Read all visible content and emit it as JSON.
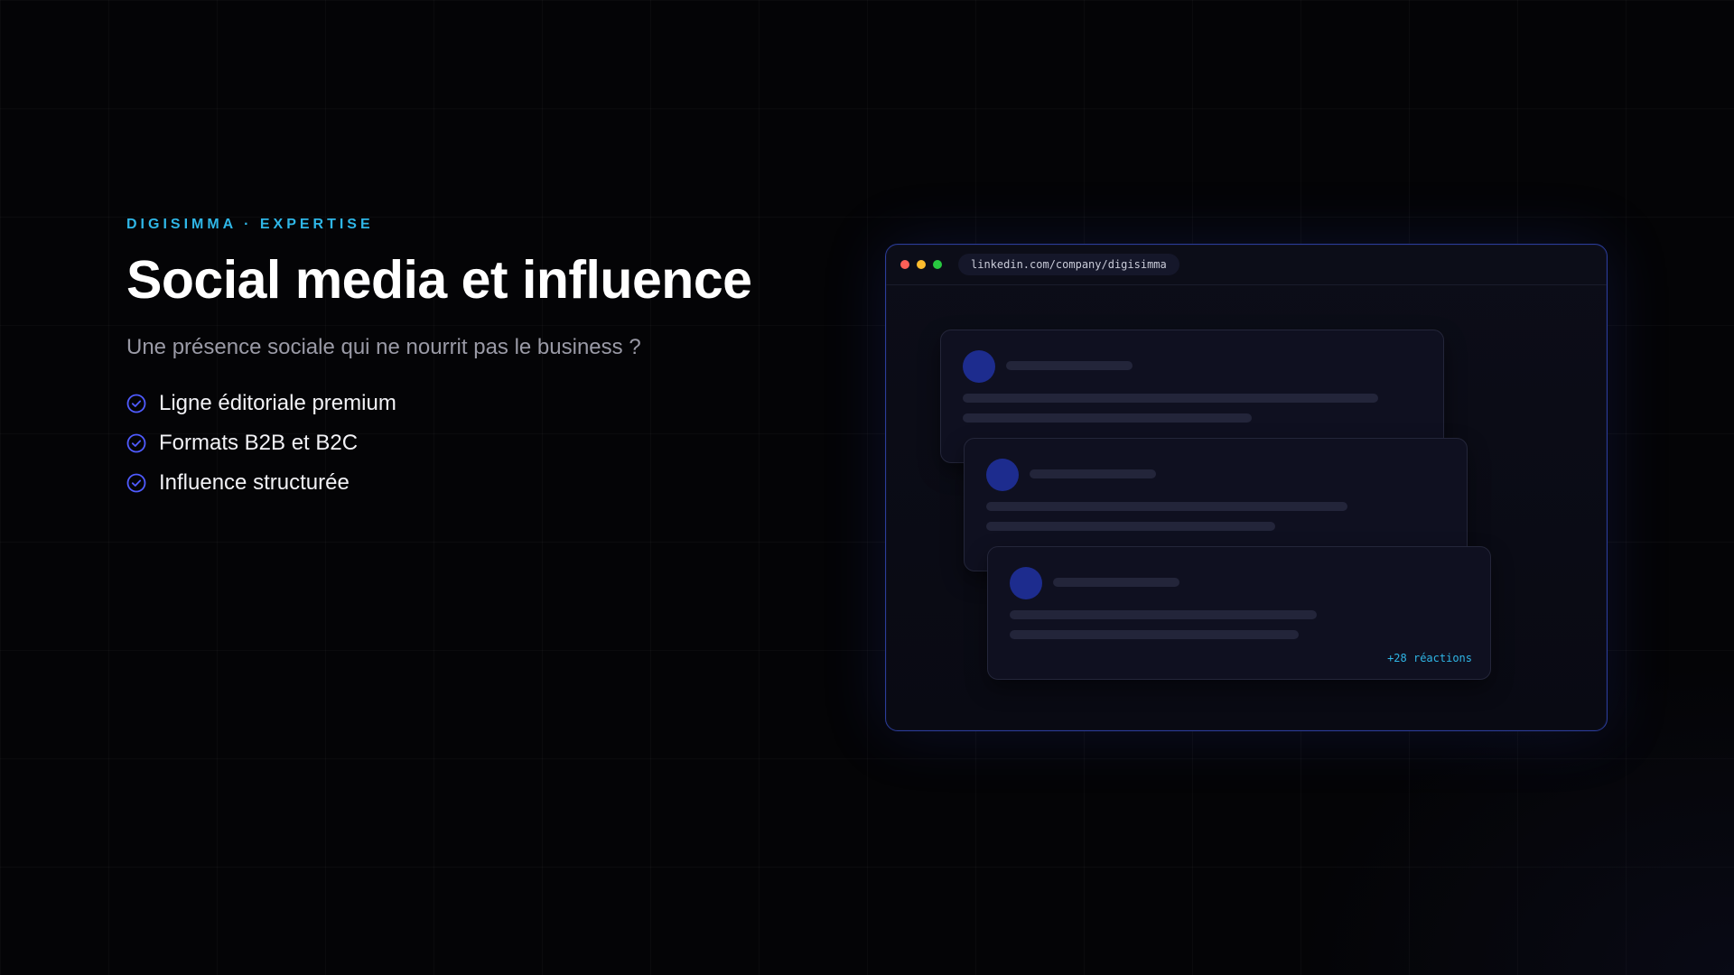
{
  "header": {
    "eyebrow": "DIGISIMMA · EXPERTISE",
    "title": "Social media et influence",
    "subtitle": "Une présence sociale qui ne nourrit pas le business ?"
  },
  "bullets": [
    {
      "label": "Ligne éditoriale premium",
      "icon": "check-circle-icon"
    },
    {
      "label": "Formats B2B et B2C",
      "icon": "check-circle-icon"
    },
    {
      "label": "Influence structurée",
      "icon": "check-circle-icon"
    }
  ],
  "browser": {
    "url": "linkedin.com/company/digisimma",
    "window_controls": [
      "close-dot",
      "minimize-dot",
      "maximize-dot"
    ],
    "posts": [
      {
        "reactions": ""
      },
      {
        "reactions": ""
      },
      {
        "reactions": "+28 réactions"
      }
    ]
  },
  "colors": {
    "background": "#040406",
    "accent_cyan": "#2fb6e6",
    "accent_blue": "#4f5bff",
    "avatar_blue": "#1d2c8e",
    "dot_red": "#ff5f57",
    "dot_yellow": "#febc2e",
    "dot_green": "#28c840"
  }
}
